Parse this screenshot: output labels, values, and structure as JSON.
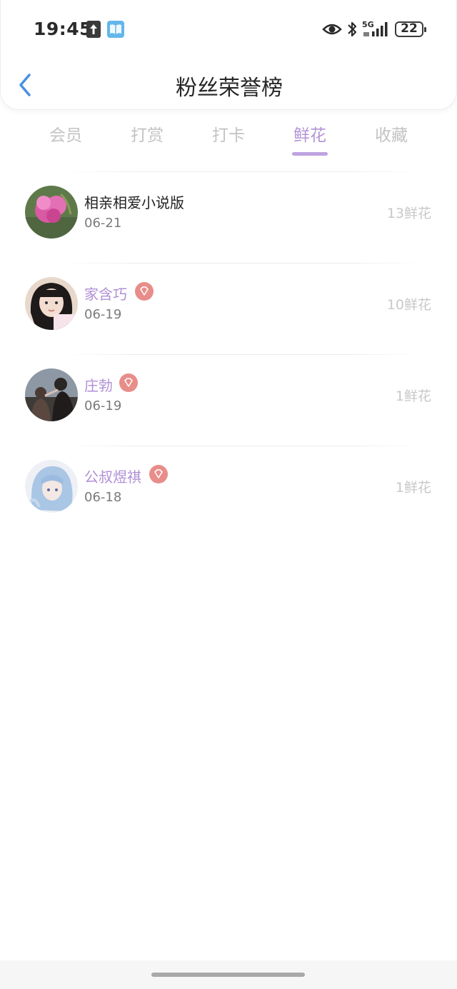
{
  "status_bar": {
    "time": "19:45",
    "network": "5G",
    "battery": "22",
    "icons": [
      "upload-icon",
      "book-icon",
      "eye-icon",
      "bluetooth-icon",
      "signal-icon",
      "battery-icon"
    ]
  },
  "header": {
    "title": "粉丝荣誉榜",
    "back_icon": "chevron-left-icon"
  },
  "tabs": [
    {
      "label": "会员",
      "active": false
    },
    {
      "label": "打赏",
      "active": false
    },
    {
      "label": "打卡",
      "active": false
    },
    {
      "label": "鲜花",
      "active": true
    },
    {
      "label": "收藏",
      "active": false
    }
  ],
  "list": [
    {
      "name": "相亲相爱小说版",
      "date": "06-21",
      "amount": "13鲜花",
      "vip": false,
      "avatar": "flower-photo"
    },
    {
      "name": "家含巧",
      "date": "06-19",
      "amount": "10鲜花",
      "vip": true,
      "avatar": "girl-photo"
    },
    {
      "name": "庄勃",
      "date": "06-19",
      "amount": "1鲜花",
      "vip": true,
      "avatar": "couple-photo"
    },
    {
      "name": "公叔煜祺",
      "date": "06-18",
      "amount": "1鲜花",
      "vip": true,
      "avatar": "anime-girl-illustration"
    }
  ],
  "colors": {
    "accent": "#b394d6",
    "vip_name": "#b08fd6",
    "badge": "#e88d89",
    "back_arrow": "#4a90e2",
    "inactive_tab": "#c3c3c3"
  }
}
